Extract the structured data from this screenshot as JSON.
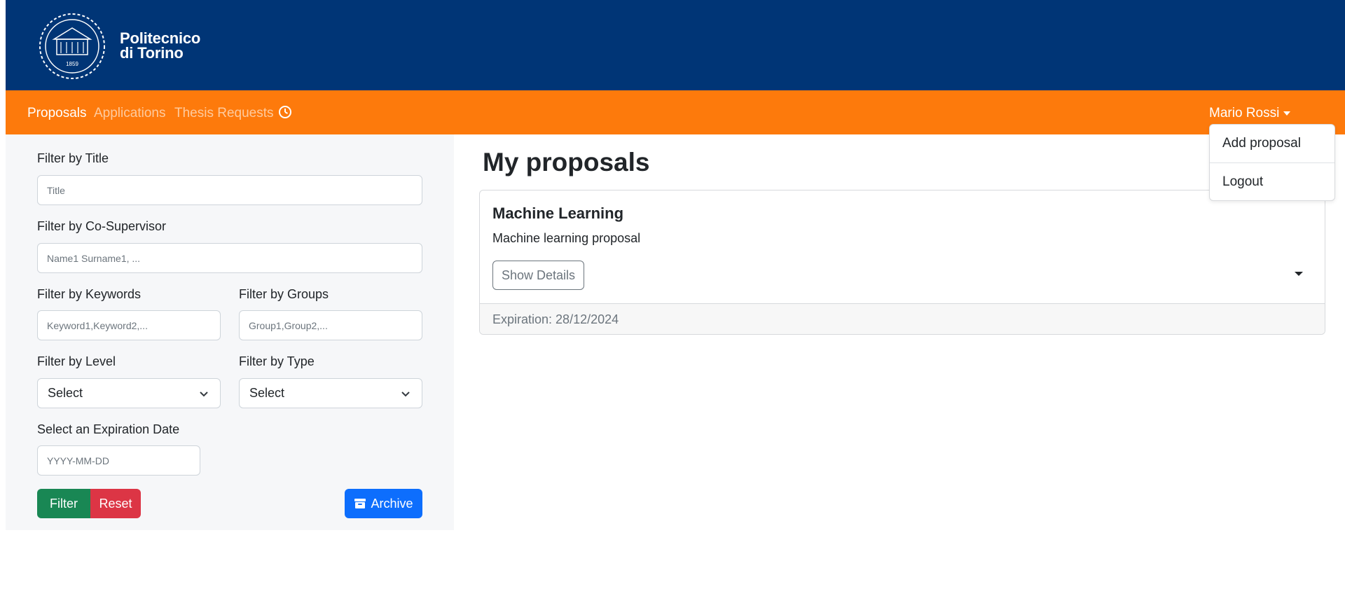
{
  "colors": {
    "header_bg": "#003576",
    "navbar_bg": "#fd7a0c",
    "filter_button": "#198754",
    "reset_button": "#dc3545",
    "archive_button": "#0d6efd"
  },
  "header": {
    "logo_line1": "Politecnico",
    "logo_line2": "di Torino",
    "logo_year": "1859",
    "logo_icon": "university-seal-icon"
  },
  "navbar": {
    "links": [
      {
        "label": "Proposals",
        "active": true
      },
      {
        "label": "Applications",
        "active": false
      },
      {
        "label": "Thesis Requests",
        "active": false
      }
    ],
    "history_icon": "clock-icon",
    "user_name": "Mario Rossi",
    "user_menu": {
      "open": true,
      "items": [
        "Add proposal",
        "Logout"
      ]
    }
  },
  "filters": {
    "title": {
      "label": "Filter by Title",
      "placeholder": "Title",
      "value": ""
    },
    "co_supervisor": {
      "label": "Filter by Co-Supervisor",
      "placeholder": "Name1 Surname1, ...",
      "value": ""
    },
    "keywords": {
      "label": "Filter by Keywords",
      "placeholder": "Keyword1,Keyword2,...",
      "value": ""
    },
    "groups": {
      "label": "Filter by Groups",
      "placeholder": "Group1,Group2,...",
      "value": ""
    },
    "level": {
      "label": "Filter by Level",
      "selected": "Select"
    },
    "type": {
      "label": "Filter by Type",
      "selected": "Select"
    },
    "expiration": {
      "label": "Select an Expiration Date",
      "placeholder": "YYYY-MM-DD",
      "value": ""
    },
    "filter_button": "Filter",
    "reset_button": "Reset",
    "archive_button": "Archive",
    "archive_icon": "archive-box-icon"
  },
  "main": {
    "title": "My proposals",
    "proposals": [
      {
        "title": "Machine Learning",
        "description": "Machine learning proposal",
        "details_button": "Show Details",
        "expiration": "Expiration: 28/12/2024"
      }
    ]
  }
}
